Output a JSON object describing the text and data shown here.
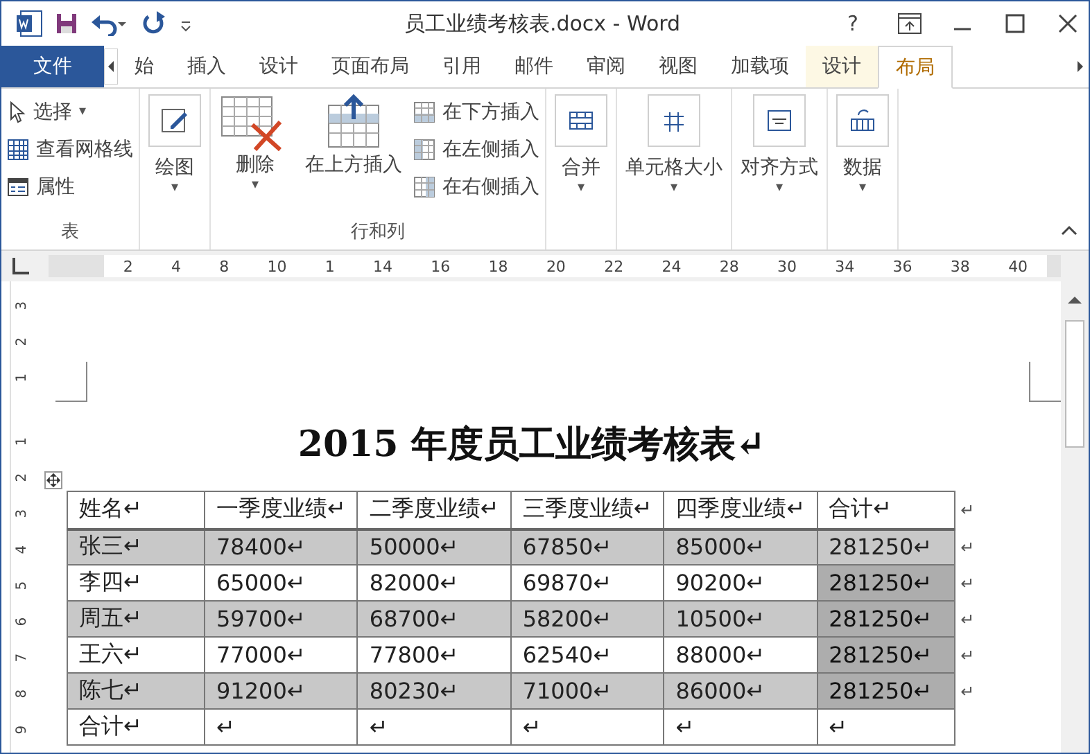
{
  "window": {
    "title": "员工业绩考核表.docx - Word",
    "help": "?"
  },
  "tabs": [
    {
      "label": "文件",
      "kind": "file",
      "selected": false
    },
    {
      "label": "始",
      "kind": "normal",
      "selected": false
    },
    {
      "label": "插入",
      "kind": "normal",
      "selected": false
    },
    {
      "label": "设计",
      "kind": "normal",
      "selected": false
    },
    {
      "label": "页面布局",
      "kind": "normal",
      "selected": false
    },
    {
      "label": "引用",
      "kind": "normal",
      "selected": false
    },
    {
      "label": "邮件",
      "kind": "normal",
      "selected": false
    },
    {
      "label": "审阅",
      "kind": "normal",
      "selected": false
    },
    {
      "label": "视图",
      "kind": "normal",
      "selected": false
    },
    {
      "label": "加载项",
      "kind": "normal",
      "selected": false
    },
    {
      "label": "设计",
      "kind": "context",
      "selected": false
    },
    {
      "label": "布局",
      "kind": "context",
      "selected": true
    }
  ],
  "ribbon": {
    "table_group": {
      "label": "表",
      "items": [
        {
          "label": "选择",
          "kind": "select",
          "caret": "▾"
        },
        {
          "label": "查看网格线",
          "kind": "grid"
        },
        {
          "label": "属性",
          "kind": "props"
        }
      ]
    },
    "draw": {
      "label": "绘图",
      "caret": "▾"
    },
    "rows_cols": {
      "label": "行和列",
      "delete": {
        "label": "删除",
        "caret": "▾"
      },
      "insert_above": "在上方插入",
      "small": [
        {
          "label": "在下方插入",
          "kind": "below"
        },
        {
          "label": "在左侧插入",
          "kind": "left"
        },
        {
          "label": "在右侧插入",
          "kind": "right"
        }
      ]
    },
    "big_buttons": [
      {
        "label": "合并",
        "kind": "merge",
        "caret": "▾"
      },
      {
        "label": "单元格大小",
        "kind": "size",
        "caret": "▾"
      },
      {
        "label": "对齐方式",
        "kind": "align",
        "caret": "▾"
      },
      {
        "label": "数据",
        "kind": "data",
        "caret": "▾"
      }
    ]
  },
  "ruler": {
    "labels": [
      "2",
      "4",
      "8",
      "10",
      "1",
      "14",
      "16",
      "18",
      "20",
      "22",
      "24",
      "28",
      "30",
      "34",
      "36",
      "38",
      "40"
    ]
  },
  "vruler": {
    "labels": [
      "3",
      "2",
      "1",
      "1",
      "2",
      "3",
      "4",
      "5",
      "6",
      "7",
      "8",
      "9"
    ]
  },
  "document": {
    "heading": "2015 年度员工业绩考核表↵",
    "table": {
      "columns": [
        "姓名↵",
        "一季度业绩↵",
        "二季度业绩↵",
        "三季度业绩↵",
        "四季度业绩↵",
        "合计↵"
      ],
      "header_end": "↵",
      "rows": [
        {
          "shaded": true,
          "cells": [
            "张三↵",
            "78400↵",
            "50000↵",
            "67850↵",
            "85000↵",
            "281250↵"
          ],
          "total_selected": false,
          "end": "↵"
        },
        {
          "shaded": false,
          "cells": [
            "李四↵",
            "65000↵",
            "82000↵",
            "69870↵",
            "90200↵",
            "281250↵"
          ],
          "total_selected": true,
          "end": "↵"
        },
        {
          "shaded": true,
          "cells": [
            "周五↵",
            "59700↵",
            "68700↵",
            "58200↵",
            "10500↵",
            "281250↵"
          ],
          "total_selected": true,
          "end": "↵"
        },
        {
          "shaded": false,
          "cells": [
            "王六↵",
            "77000↵",
            "77800↵",
            "62540↵",
            "88000↵",
            "281250↵"
          ],
          "total_selected": true,
          "end": "↵"
        },
        {
          "shaded": true,
          "cells": [
            "陈七↵",
            "91200↵",
            "80230↵",
            "71000↵",
            "86000↵",
            "281250↵"
          ],
          "total_selected": true,
          "end": "↵"
        },
        {
          "shaded": false,
          "cells": [
            "合计↵",
            "↵",
            "↵",
            "↵",
            "↵",
            "↵"
          ],
          "total_selected": false,
          "end": ""
        }
      ]
    }
  }
}
